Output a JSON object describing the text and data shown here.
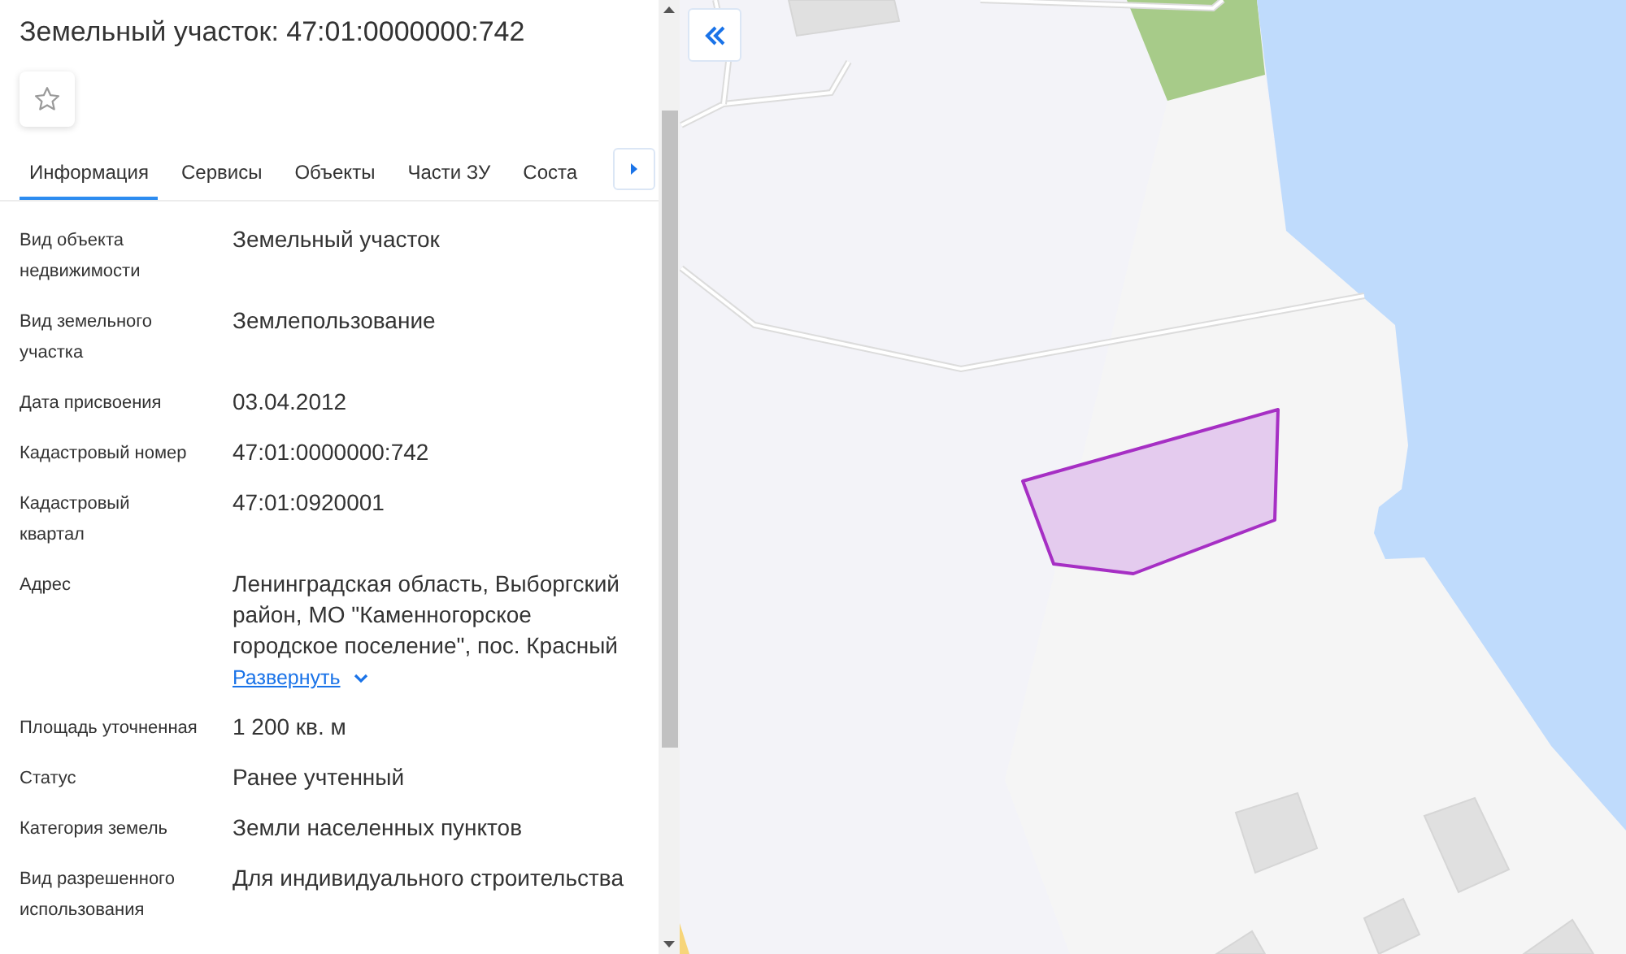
{
  "panel": {
    "title": "Земельный участок: 47:01:0000000:742",
    "favorite": {
      "checked": false
    },
    "tabs": [
      {
        "label": "Информация",
        "selected": true
      },
      {
        "label": "Сервисы",
        "selected": false
      },
      {
        "label": "Объекты",
        "selected": false
      },
      {
        "label": "Части ЗУ",
        "selected": false
      },
      {
        "label": "Соста",
        "selected": false
      }
    ],
    "fields": [
      {
        "label": "Вид объекта недвижимости",
        "value": "Земельный участок"
      },
      {
        "label": "Вид земельного участка",
        "value": "Землепользование"
      },
      {
        "label": "Дата присвоения",
        "value": "03.04.2012"
      },
      {
        "label": "Кадастровый номер",
        "value": "47:01:0000000:742"
      },
      {
        "label": "Кадастровый квартал",
        "value": "47:01:0920001"
      },
      {
        "label": "Адрес",
        "value": "Ленинградская область, Выборгский район, МО \"Каменногорское городское поселение\", пос. Красный",
        "expand_link": "Развернуть"
      },
      {
        "label": "Площадь уточненная",
        "value": "1 200 кв. м"
      },
      {
        "label": "Статус",
        "value": "Ранее учтенный"
      },
      {
        "label": "Категория земель",
        "value": "Земли населенных пунктов"
      },
      {
        "label": "Вид разрешенного использования",
        "value": "Для индивидуального строительства"
      }
    ]
  }
}
